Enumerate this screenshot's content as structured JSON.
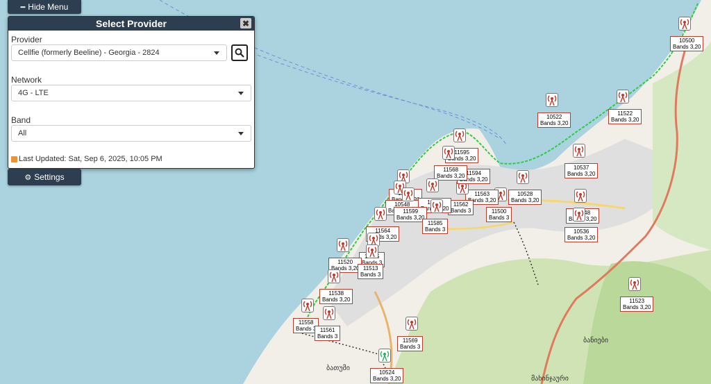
{
  "menu": {
    "hide_label": "Hide Menu",
    "settings_label": "Settings"
  },
  "panel": {
    "title": "Select Provider",
    "close_glyph": "✖",
    "provider_label": "Provider",
    "provider_value": "Cellfie (formerly Beeline) - Georgia - 2824",
    "network_label": "Network",
    "network_value": "4G - LTE",
    "band_label": "Band",
    "band_value": "All",
    "last_updated": "Last Updated: Sat, Sep 6, 2025, 10:05 PM"
  },
  "map_texts": [
    {
      "text": "ბათუმი",
      "color": "#333"
    },
    {
      "text": "ბანიები",
      "color": "#333"
    },
    {
      "text": "მახინჯაური",
      "color": "#333"
    }
  ],
  "colors": {
    "tower": "#c0392b",
    "tower_green": "#27ae60",
    "route": "#2ecc40",
    "road": "#e07a5f"
  },
  "markers": [
    {
      "id": "10500",
      "bands": "Bands 3,20"
    },
    {
      "id": "10522",
      "bands": "Bands 3,20"
    },
    {
      "id": "11522",
      "bands": "Bands 3,20"
    },
    {
      "id": "10537",
      "bands": "Bands 3,20"
    },
    {
      "id": "11548",
      "bands": "Bands 3,20"
    },
    {
      "id": "10536",
      "bands": "Bands 3,20"
    },
    {
      "id": "11523",
      "bands": "Bands 3,20"
    },
    {
      "id": "10528",
      "bands": "Bands 3,20"
    },
    {
      "id": "11500",
      "bands": "Bands 3"
    },
    {
      "id": "11563",
      "bands": "Bands 3,20"
    },
    {
      "id": "11562",
      "bands": "Bands 3"
    },
    {
      "id": "11594",
      "bands": "Bands 3,20"
    },
    {
      "id": "11595",
      "bands": "Bands 3,20"
    },
    {
      "id": "11568",
      "bands": "Bands 3,20"
    },
    {
      "id": "10521",
      "bands": "Bands 3,20"
    },
    {
      "id": "10548",
      "bands": "Bands 3,20"
    },
    {
      "id": "11557",
      "bands": "Bands 3,20"
    },
    {
      "id": "11599",
      "bands": "Bands 3,20"
    },
    {
      "id": "11585",
      "bands": "Bands 3"
    },
    {
      "id": "11564",
      "bands": "Bands 3,20"
    },
    {
      "id": "11565",
      "bands": "Bands 3"
    },
    {
      "id": "11520",
      "bands": "Bands 3,20"
    },
    {
      "id": "11513",
      "bands": "Bands 3"
    },
    {
      "id": "11538",
      "bands": "Bands 3,20"
    },
    {
      "id": "11558",
      "bands": "Bands 3"
    },
    {
      "id": "11561",
      "bands": "Bands 3"
    },
    {
      "id": "11569",
      "bands": "Bands 3"
    },
    {
      "id": "10524",
      "bands": "Bands 3,20"
    }
  ]
}
